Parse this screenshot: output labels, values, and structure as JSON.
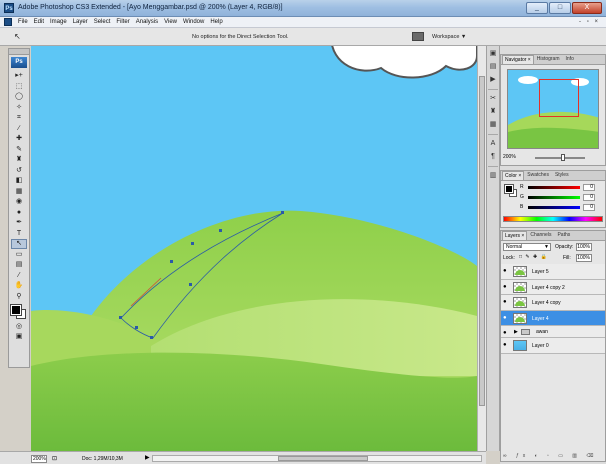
{
  "window": {
    "title": "Adobe Photoshop CS3 Extended - [Ayo Menggambar.psd @ 200% (Layer 4, RGB/8)]",
    "app_icon": "Ps",
    "controls": [
      "_",
      "□",
      "X"
    ]
  },
  "menu": {
    "items": [
      "File",
      "Edit",
      "Image",
      "Layer",
      "Select",
      "Filter",
      "Analysis",
      "View",
      "Window",
      "Help"
    ],
    "right_controls": "- ▫ ×"
  },
  "options": {
    "tool_icon": "direct-selection-arrow-icon",
    "tool_glyph": "↖",
    "message": "No options for the Direct Selection Tool.",
    "workspace_label": "Workspace ▼"
  },
  "toolbox": {
    "logo": "Ps",
    "tools": [
      {
        "name": "move-tool-icon",
        "glyph": "▸+"
      },
      {
        "name": "marquee-tool-icon",
        "glyph": "⬚"
      },
      {
        "name": "lasso-tool-icon",
        "glyph": "◯"
      },
      {
        "name": "magic-wand-tool-icon",
        "glyph": "✧"
      },
      {
        "name": "crop-tool-icon",
        "glyph": "⌗"
      },
      {
        "name": "slice-tool-icon",
        "glyph": "∕"
      },
      {
        "name": "healing-brush-tool-icon",
        "glyph": "✚"
      },
      {
        "name": "brush-tool-icon",
        "glyph": "✎"
      },
      {
        "name": "clone-stamp-tool-icon",
        "glyph": "♜"
      },
      {
        "name": "history-brush-tool-icon",
        "glyph": "↺"
      },
      {
        "name": "eraser-tool-icon",
        "glyph": "◧"
      },
      {
        "name": "gradient-tool-icon",
        "glyph": "▦"
      },
      {
        "name": "blur-tool-icon",
        "glyph": "◉"
      },
      {
        "name": "dodge-tool-icon",
        "glyph": "●"
      },
      {
        "name": "pen-tool-icon",
        "glyph": "✒"
      },
      {
        "name": "type-tool-icon",
        "glyph": "T"
      },
      {
        "name": "direct-selection-tool-icon",
        "glyph": "↖"
      },
      {
        "name": "shape-tool-icon",
        "glyph": "▭"
      },
      {
        "name": "notes-tool-icon",
        "glyph": "▤"
      },
      {
        "name": "eyedropper-tool-icon",
        "glyph": "⁄"
      },
      {
        "name": "hand-tool-icon",
        "glyph": "✋"
      },
      {
        "name": "zoom-tool-icon",
        "glyph": "⚲"
      }
    ],
    "quick_mask_glyph": "◎",
    "screen_mode_glyph": "▣",
    "colors": {
      "foreground": "#000000",
      "background": "#ffffff"
    }
  },
  "status": {
    "zoom": "200%",
    "doc": "Doc: 1,29M/10,3M",
    "icon_glyph": "⊡",
    "play_glyph": "▶"
  },
  "dock_icons": [
    {
      "name": "navigator-dock-icon",
      "glyph": "▣"
    },
    {
      "name": "histogram-dock-icon",
      "glyph": "▤"
    },
    {
      "name": "info-dock-icon",
      "glyph": "▶"
    },
    {
      "name": "tools-dock-icon",
      "glyph": "✂"
    },
    {
      "name": "clone-source-dock-icon",
      "glyph": "♜"
    },
    {
      "name": "actions-dock-icon",
      "glyph": "▦"
    },
    {
      "name": "character-dock-icon",
      "glyph": "A"
    },
    {
      "name": "paragraph-dock-icon",
      "glyph": "¶"
    },
    {
      "name": "layer-comps-dock-icon",
      "glyph": "▥"
    }
  ],
  "navigator": {
    "tabs": [
      "Navigator ×",
      "Histogram",
      "Info"
    ],
    "zoom": "200%",
    "slider_fraction": 0.55
  },
  "color_panel": {
    "tabs": [
      "Color ×",
      "Swatches",
      "Styles"
    ],
    "channels": [
      {
        "label": "R",
        "value": "0"
      },
      {
        "label": "G",
        "value": "0"
      },
      {
        "label": "B",
        "value": "0"
      }
    ]
  },
  "layers": {
    "tabs": [
      "Layers ×",
      "Channels",
      "Paths"
    ],
    "blend_mode": "Normal",
    "opacity_label": "Opacity:",
    "opacity": "100%",
    "lock_label": "Lock:",
    "fill_label": "Fill:",
    "fill": "100%",
    "items": [
      {
        "name": "Layer 5",
        "type": "layer",
        "thumb": "green",
        "selected": false
      },
      {
        "name": "Layer 4 copy 2",
        "type": "layer",
        "thumb": "green",
        "selected": false
      },
      {
        "name": "Layer 4 copy",
        "type": "layer",
        "thumb": "green",
        "selected": false
      },
      {
        "name": "Layer 4",
        "type": "layer",
        "thumb": "green",
        "selected": true
      },
      {
        "name": "awan",
        "type": "group",
        "thumb": "",
        "selected": false
      },
      {
        "name": "Layer 0",
        "type": "layer",
        "thumb": "sky",
        "selected": false
      }
    ],
    "footer_icons": "∞ ƒx ◐ ▫ ▭ ▥ ⌫"
  },
  "colors": {
    "sky": "#5dc6f5",
    "hill_front": "#79c543",
    "hill_back": "#a6d85a",
    "selection_blue": "#3d8fe4",
    "path": "#2a5aa8",
    "nav_view_box": "#e53127"
  }
}
